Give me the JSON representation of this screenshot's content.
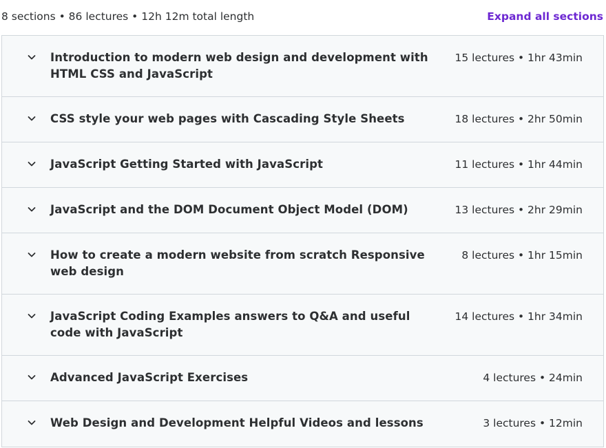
{
  "summary": {
    "text": "8 sections • 86 lectures • 12h 12m total length",
    "expand_label": "Expand all sections"
  },
  "colors": {
    "accent": "#6d28d2",
    "row_background": "#f7f9fa",
    "border": "#d1d7dc",
    "text": "#2d2f31"
  },
  "icons": {
    "row_toggle": "chevron-down-icon"
  },
  "sections": [
    {
      "title": "Introduction to modern web design and development with HTML CSS and JavaScript",
      "meta": "15 lectures • 1hr 43min",
      "lines": 2
    },
    {
      "title": "CSS style your web pages with Cascading Style Sheets",
      "meta": "18 lectures • 2hr 50min",
      "lines": 1
    },
    {
      "title": "JavaScript Getting Started with JavaScript",
      "meta": "11 lectures • 1hr 44min",
      "lines": 1
    },
    {
      "title": "JavaScript and the DOM Document Object Model (DOM)",
      "meta": "13 lectures • 2hr 29min",
      "lines": 1
    },
    {
      "title": "How to create a modern website from scratch Responsive web design",
      "meta": "8 lectures • 1hr 15min",
      "lines": 2
    },
    {
      "title": "JavaScript Coding Examples answers to Q&A and useful code with JavaScript",
      "meta": "14 lectures • 1hr 34min",
      "lines": 2
    },
    {
      "title": "Advanced JavaScript Exercises",
      "meta": "4 lectures • 24min",
      "lines": 1
    },
    {
      "title": "Web Design and Development Helpful Videos and lessons",
      "meta": "3 lectures • 12min",
      "lines": 1
    }
  ]
}
